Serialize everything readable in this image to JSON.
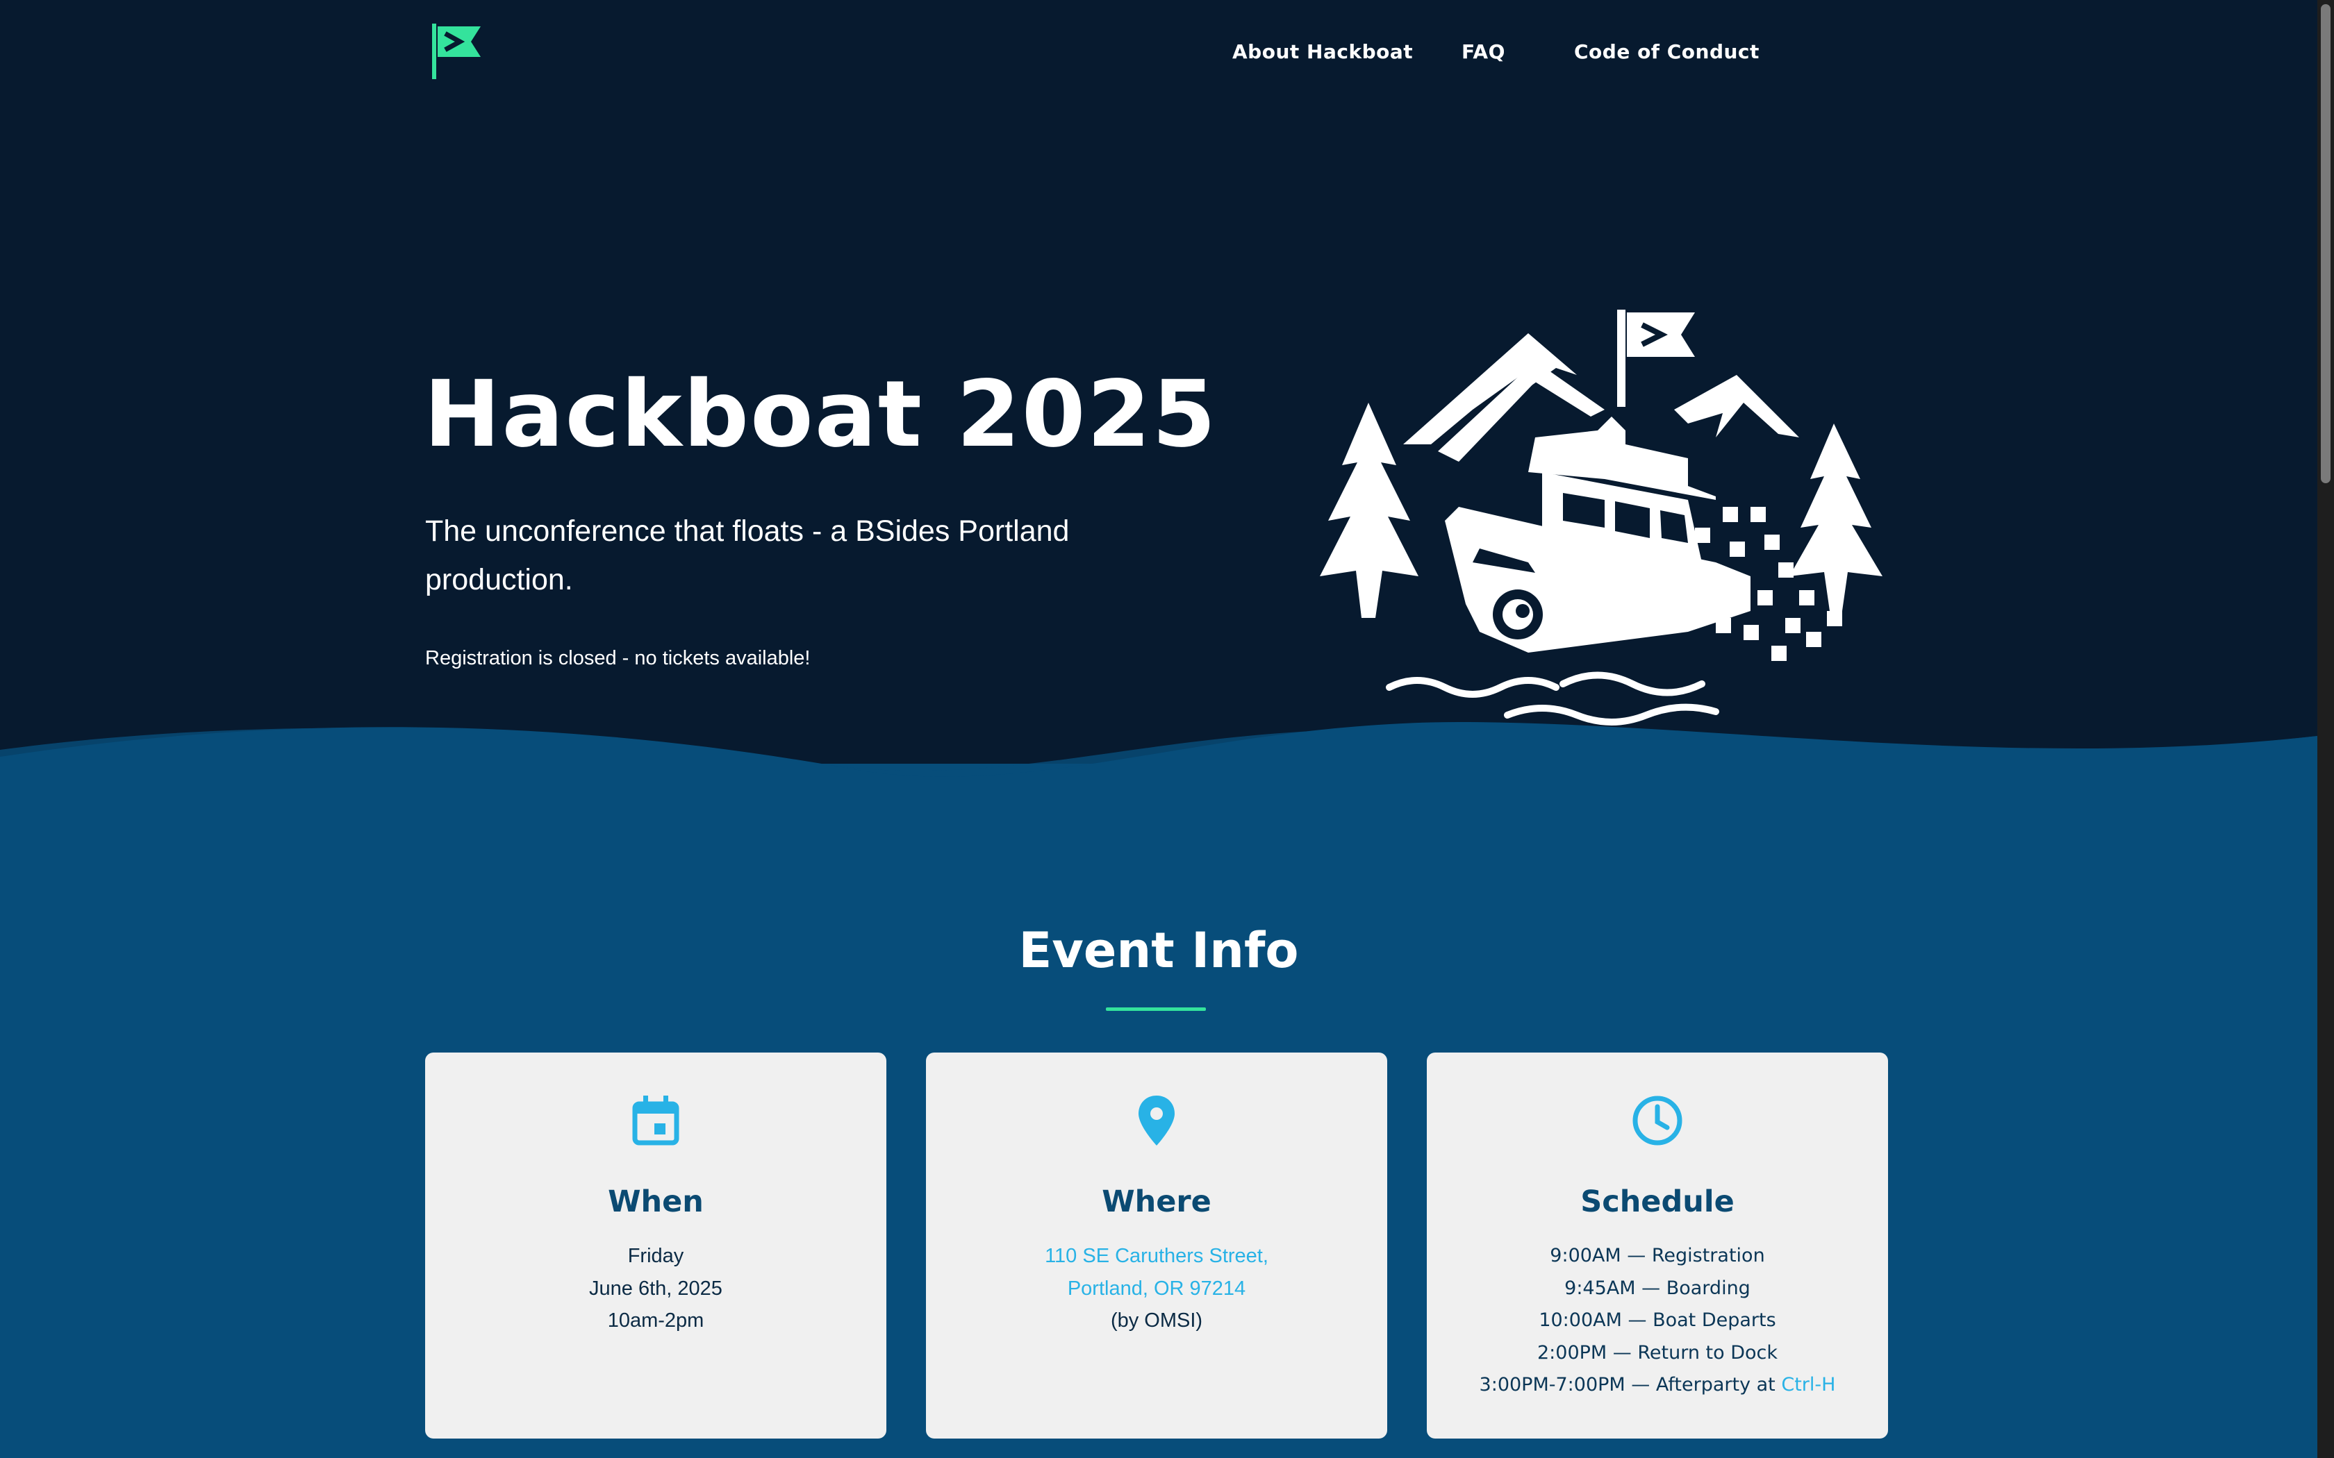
{
  "colors": {
    "background": "#071a2f",
    "section": "#074d7a",
    "accent": "#34e39c",
    "link": "#28b2e6",
    "card": "#f0f0f0",
    "card_heading": "#0b4a72"
  },
  "header": {
    "logo_icon": "flag-logo-icon",
    "nav": [
      {
        "label": "About Hackboat"
      },
      {
        "label": "FAQ"
      },
      {
        "label": "Code of Conduct"
      }
    ]
  },
  "hero": {
    "title": "Hackboat 2025",
    "subtitle": "The unconference that floats - a BSides Portland production.",
    "note": "Registration is closed - no tickets available!",
    "illustration_icon": "boat-mountains-trees-illustration"
  },
  "event_info": {
    "title": "Event Info",
    "cards": [
      {
        "icon": "calendar-icon",
        "heading": "When",
        "lines": [
          "Friday",
          "June 6th, 2025",
          "10am-2pm"
        ]
      },
      {
        "icon": "location-pin-icon",
        "heading": "Where",
        "address_line1": "110 SE Caruthers Street,",
        "address_line2": "Portland, OR 97214",
        "note": "(by OMSI)"
      },
      {
        "icon": "clock-icon",
        "heading": "Schedule",
        "lines": [
          "9:00AM — Registration",
          "9:45AM — Boarding",
          "10:00AM — Boat Departs",
          "2:00PM — Return to Dock"
        ],
        "last_line_prefix": "3:00PM-7:00PM — Afterparty at ",
        "last_line_link": "Ctrl-H"
      }
    ]
  }
}
